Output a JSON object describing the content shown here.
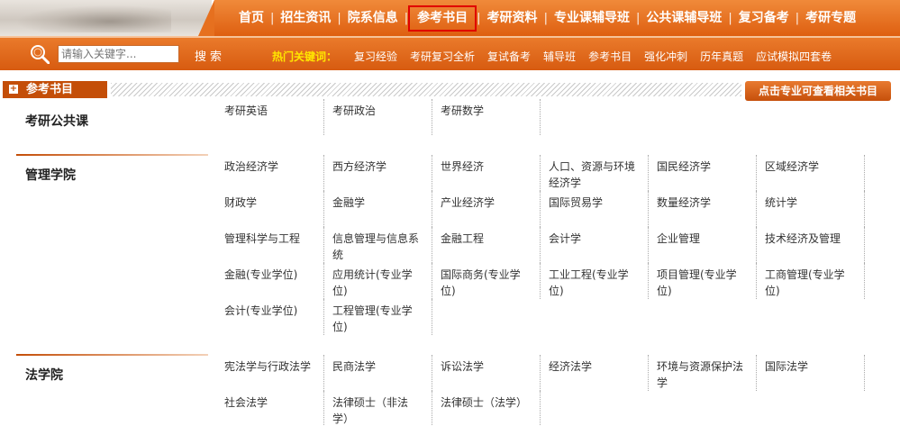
{
  "nav": {
    "items": [
      "首页",
      "招生资讯",
      "院系信息",
      "参考书目",
      "考研资料",
      "专业课辅导班",
      "公共课辅导班",
      "复习备考",
      "考研专题"
    ],
    "active_index": 3
  },
  "search": {
    "placeholder": "请输入关键字...",
    "button": "搜索",
    "hot_label": "热门关键词：",
    "hot_keywords": [
      "复习经验",
      "考研复习全析",
      "复试备考",
      "辅导班",
      "参考书目",
      "强化冲刺",
      "历年真题",
      "应试模拟四套卷"
    ]
  },
  "section": {
    "title": "参考书目",
    "right_link": "点击专业可查看相关书目"
  },
  "departments": [
    {
      "name": "考研公共课",
      "rows": [
        [
          "考研英语",
          "考研政治",
          "考研数学"
        ]
      ]
    },
    {
      "name": "管理学院",
      "rows": [
        [
          "政治经济学",
          "西方经济学",
          "世界经济",
          "人口、资源与环境经济学",
          "国民经济学",
          "区域经济学"
        ],
        [
          "财政学",
          "金融学",
          "产业经济学",
          "国际贸易学",
          "数量经济学",
          "统计学"
        ],
        [
          "管理科学与工程",
          "信息管理与信息系统",
          "金融工程",
          "会计学",
          "企业管理",
          "技术经济及管理"
        ],
        [
          "金融(专业学位)",
          "应用统计(专业学位)",
          "国际商务(专业学位)",
          "工业工程(专业学位)",
          "项目管理(专业学位)",
          "工商管理(专业学位)"
        ],
        [
          "会计(专业学位)",
          "工程管理(专业学位)"
        ]
      ]
    },
    {
      "name": "法学院",
      "rows": [
        [
          "宪法学与行政法学",
          "民商法学",
          "诉讼法学",
          "经济法学",
          "环境与资源保护法学",
          "国际法学"
        ],
        [
          "社会法学",
          "法律硕士（非法学）",
          "法律硕士（法学）"
        ]
      ]
    }
  ],
  "colors": {
    "nav_orange": "#e2651a",
    "dark_orange": "#c44e08",
    "hot_yellow": "#ffe600",
    "active_border": "#e00000"
  }
}
